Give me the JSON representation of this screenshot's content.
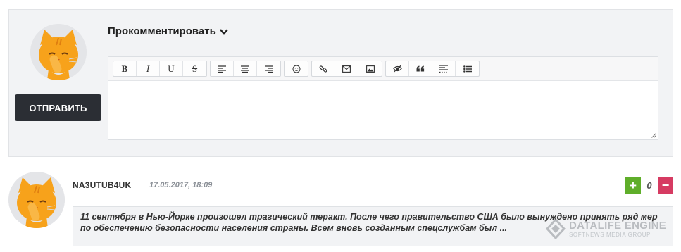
{
  "comment_form": {
    "title": "Прокомментировать",
    "send_label": "ОТПРАВИТЬ",
    "textarea_value": "",
    "toolbar": {
      "groups": [
        [
          {
            "icon": "bold-icon",
            "label": "B"
          },
          {
            "icon": "italic-icon",
            "label": "I"
          },
          {
            "icon": "underline-icon",
            "label": "U"
          },
          {
            "icon": "strikethrough-icon",
            "label": "S"
          }
        ],
        [
          {
            "icon": "align-left-icon"
          },
          {
            "icon": "align-center-icon"
          },
          {
            "icon": "align-right-icon"
          }
        ],
        [
          {
            "icon": "smiley-icon"
          }
        ],
        [
          {
            "icon": "link-icon"
          },
          {
            "icon": "email-icon"
          },
          {
            "icon": "image-icon"
          }
        ],
        [
          {
            "icon": "hide-icon"
          },
          {
            "icon": "quote-icon"
          },
          {
            "icon": "spoiler-icon"
          },
          {
            "icon": "list-icon"
          }
        ]
      ]
    }
  },
  "comment": {
    "author": "NA3UTUB4UK",
    "date": "17.05.2017, 18:09",
    "rating": {
      "plus": "+",
      "value": "0",
      "minus": "−"
    },
    "text": "11 сентября в Нью-Йорке произошел трагический теракт. После чего правительство США было вынуждено принять ряд мер по обеспечению безопасности населения страны. Всем вновь созданным спецслужбам был ..."
  },
  "watermark": {
    "main": "DATALIFE ENGINE",
    "sub": "SOFTNEWS MEDIA GROUP"
  },
  "colors": {
    "plus": "#5fae2a",
    "minus": "#d63b62",
    "button": "#2b2e34",
    "panel": "#f2f3f5",
    "cat": "#f7a21b"
  }
}
